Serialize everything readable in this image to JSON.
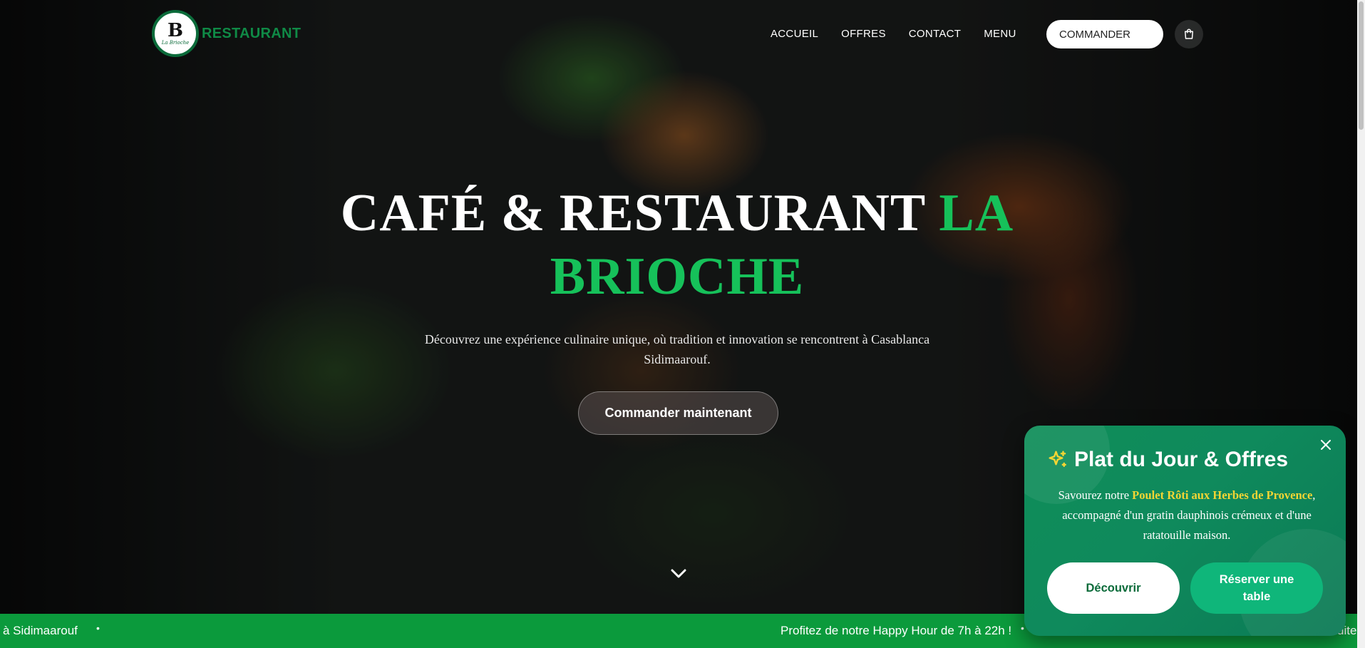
{
  "nav": {
    "logo_letter": "B",
    "logo_script": "La Brioche",
    "brand": "RESTAURANT",
    "links": [
      "ACCUEIL",
      "OFFRES",
      "CONTACT",
      "MENU"
    ],
    "order_label": "COMMANDER",
    "cart_icon": "shopping-bag-icon"
  },
  "hero": {
    "title_white": "CAFÉ & RESTAURANT",
    "title_green": "LA BRIOCHE",
    "subtitle": "Découvrez une expérience culinaire unique, où tradition et innovation se rencontrent à Casablanca Sidimaarouf.",
    "cta": "Commander maintenant",
    "scroll_icon": "chevron-down-icon"
  },
  "ticker": {
    "items": [
      "à Sidimaarouf",
      "Profitez de notre Happy Hour de 7h à 22h !",
      "uite"
    ],
    "separator": "•"
  },
  "promo": {
    "icon": "sparkles-icon",
    "title": "Plat du Jour & Offres",
    "text_before": "Savourez notre",
    "highlight": "Poulet Rôti aux Herbes de Provence",
    "text_after": ", accompagné d'un gratin dauphinois crémeux et d'une ratatouille maison.",
    "discover_label": "Découvrir",
    "reserve_label": "Réserver une table",
    "close_icon": "close-icon"
  },
  "colors": {
    "accent_green": "#16c15a",
    "brand_green": "#0f8a46",
    "ticker_bg": "#0b9a3c",
    "promo_bg": "#0f8a5c",
    "highlight_yellow": "#f3d534"
  }
}
